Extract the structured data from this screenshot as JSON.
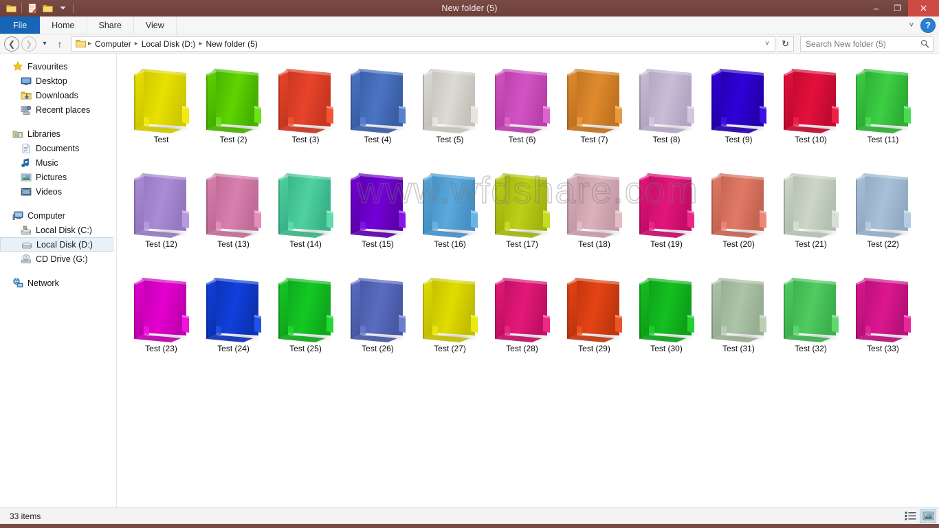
{
  "window": {
    "title": "New folder (5)",
    "quick_access": [
      "folder-icon",
      "properties-icon",
      "new-folder-icon",
      "customize-caret-icon"
    ],
    "minimize_label": "–",
    "maximize_label": "❐",
    "close_label": "✕"
  },
  "ribbon": {
    "tabs": [
      {
        "label": "File",
        "active_file": true
      },
      {
        "label": "Home",
        "active_file": false
      },
      {
        "label": "Share",
        "active_file": false
      },
      {
        "label": "View",
        "active_file": false
      }
    ],
    "expand_caret": "˅",
    "help_label": "?"
  },
  "address": {
    "back_label": "❮",
    "forward_label": "❯",
    "recent_caret": "▾",
    "up_label": "↑",
    "breadcrumbs": [
      "Computer",
      "Local Disk (D:)",
      "New folder (5)"
    ],
    "separator": "▸",
    "dropdown_caret": "˅",
    "refresh_label": "↻"
  },
  "search": {
    "placeholder": "Search New folder (5)",
    "value": "",
    "icon": "search-icon"
  },
  "sidebar": {
    "groups": [
      {
        "name": "Favourites",
        "icon": "star-icon",
        "items": [
          {
            "label": "Desktop",
            "icon": "desktop-icon"
          },
          {
            "label": "Downloads",
            "icon": "downloads-icon"
          },
          {
            "label": "Recent places",
            "icon": "recent-places-icon"
          }
        ]
      },
      {
        "name": "Libraries",
        "icon": "libraries-icon",
        "items": [
          {
            "label": "Documents",
            "icon": "document-icon"
          },
          {
            "label": "Music",
            "icon": "music-note-icon"
          },
          {
            "label": "Pictures",
            "icon": "picture-icon"
          },
          {
            "label": "Videos",
            "icon": "video-icon"
          }
        ]
      },
      {
        "name": "Computer",
        "icon": "computer-icon",
        "items": [
          {
            "label": "Local Disk (C:)",
            "icon": "system-drive-icon",
            "selected": false
          },
          {
            "label": "Local Disk (D:)",
            "icon": "drive-icon",
            "selected": true
          },
          {
            "label": "CD Drive (G:)",
            "icon": "cd-drive-icon",
            "selected": false
          }
        ]
      },
      {
        "name": "Network",
        "icon": "network-icon",
        "items": []
      }
    ]
  },
  "watermark": {
    "text": "www.wfdshare.com"
  },
  "files": [
    {
      "name": "Test",
      "front": "#e8e000",
      "back": "#cfc800",
      "tab": "#f2ea12"
    },
    {
      "name": "Test (2)",
      "front": "#5fd400",
      "back": "#46b000",
      "tab": "#6ee018"
    },
    {
      "name": "Test (3)",
      "front": "#e8442a",
      "back": "#c83620",
      "tab": "#f05434"
    },
    {
      "name": "Test (4)",
      "front": "#4a74c4",
      "back": "#3a5ea6",
      "tab": "#5880cc"
    },
    {
      "name": "Test (5)",
      "front": "#dcdad4",
      "back": "#c4c2bb",
      "tab": "#e6e4de"
    },
    {
      "name": "Test (6)",
      "front": "#d254c4",
      "back": "#b93fab",
      "tab": "#dc64ce"
    },
    {
      "name": "Test (7)",
      "front": "#e08a2e",
      "back": "#c07320",
      "tab": "#ea9a3e"
    },
    {
      "name": "Test (8)",
      "front": "#c8bcd6",
      "back": "#b3a6c2",
      "tab": "#d2c8de"
    },
    {
      "name": "Test (9)",
      "front": "#3000d8",
      "back": "#2400ac",
      "tab": "#4010e8"
    },
    {
      "name": "Test (10)",
      "front": "#e4103c",
      "back": "#c00a30",
      "tab": "#ee2048"
    },
    {
      "name": "Test (11)",
      "front": "#3ece44",
      "back": "#2cae34",
      "tab": "#4ada52"
    },
    {
      "name": "Test (12)",
      "front": "#a98cd6",
      "back": "#9478c0",
      "tab": "#b79ae0"
    },
    {
      "name": "Test (13)",
      "front": "#d87fae",
      "back": "#c06b98",
      "tab": "#e28fbc"
    },
    {
      "name": "Test (14)",
      "front": "#4fd1a0",
      "back": "#38b488",
      "tab": "#5edcae"
    },
    {
      "name": "Test (15)",
      "front": "#7400d8",
      "back": "#5c00ac",
      "tab": "#8814e8"
    },
    {
      "name": "Test (16)",
      "front": "#5aa8dc",
      "back": "#4590c4",
      "tab": "#6ab4e4"
    },
    {
      "name": "Test (17)",
      "front": "#bcd016",
      "back": "#a2b40e",
      "tab": "#c8dc24"
    },
    {
      "name": "Test (18)",
      "front": "#dcb0bc",
      "back": "#c49aa6",
      "tab": "#e4bcc6"
    },
    {
      "name": "Test (19)",
      "front": "#e4157c",
      "back": "#c40c68",
      "tab": "#ee2588"
    },
    {
      "name": "Test (20)",
      "front": "#e07a66",
      "back": "#c46452",
      "tab": "#ea8a76"
    },
    {
      "name": "Test (21)",
      "front": "#cbd6c8",
      "back": "#b4c0b1",
      "tab": "#d6e0d3"
    },
    {
      "name": "Test (22)",
      "front": "#a8c0d8",
      "back": "#92abc4",
      "tab": "#b6cce2"
    },
    {
      "name": "Test (23)",
      "front": "#e400d0",
      "back": "#c000ae",
      "tab": "#ee14dc"
    },
    {
      "name": "Test (24)",
      "front": "#1040dc",
      "back": "#0c32b4",
      "tab": "#2052e8"
    },
    {
      "name": "Test (25)",
      "front": "#14c824",
      "back": "#0ea81c",
      "tab": "#24d834"
    },
    {
      "name": "Test (26)",
      "front": "#5a6cc0",
      "back": "#4858a4",
      "tab": "#6a7ccc"
    },
    {
      "name": "Test (27)",
      "front": "#e0dc00",
      "back": "#c2be00",
      "tab": "#ece810"
    },
    {
      "name": "Test (28)",
      "front": "#e41878",
      "back": "#c01064",
      "tab": "#ee2884"
    },
    {
      "name": "Test (29)",
      "front": "#e44414",
      "back": "#c0360e",
      "tab": "#ee5422"
    },
    {
      "name": "Test (30)",
      "front": "#14c020",
      "back": "#0ea018",
      "tab": "#24d030"
    },
    {
      "name": "Test (31)",
      "front": "#aec4a8",
      "back": "#98ae92",
      "tab": "#bcd0b6"
    },
    {
      "name": "Test (32)",
      "front": "#50cc60",
      "back": "#3cb04c",
      "tab": "#60d86e"
    },
    {
      "name": "Test (33)",
      "front": "#dc1690",
      "back": "#b8107a",
      "tab": "#e8269c"
    }
  ],
  "statusbar": {
    "item_count": "33 items",
    "views": [
      {
        "icon": "details-view-icon",
        "active": false
      },
      {
        "icon": "large-icons-view-icon",
        "active": true
      }
    ]
  }
}
